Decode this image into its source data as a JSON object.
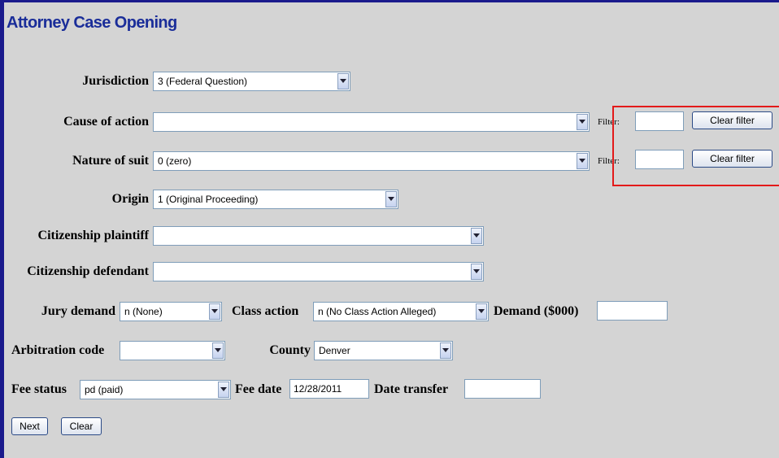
{
  "title": "Attorney Case Opening",
  "colors": {
    "title": "#1a2d99",
    "frame": "#1a1a8c",
    "highlight": "#e31a1a",
    "background": "#d4d4d4"
  },
  "fields": {
    "jurisdiction": {
      "label": "Jurisdiction",
      "value": "3 (Federal Question)"
    },
    "cause_of_action": {
      "label": "Cause of action",
      "value": ""
    },
    "nature_of_suit": {
      "label": "Nature of suit",
      "value": "0 (zero)"
    },
    "origin": {
      "label": "Origin",
      "value": "1 (Original Proceeding)"
    },
    "citizenship_plaintiff": {
      "label": "Citizenship plaintiff",
      "value": ""
    },
    "citizenship_defendant": {
      "label": "Citizenship defendant",
      "value": ""
    },
    "jury_demand": {
      "label": "Jury demand",
      "value": "n (None)"
    },
    "class_action": {
      "label": "Class action",
      "value": "n (No Class Action Alleged)"
    },
    "demand": {
      "label": "Demand ($000)",
      "value": ""
    },
    "arbitration_code": {
      "label": "Arbitration code",
      "value": ""
    },
    "county": {
      "label": "County",
      "value": "Denver"
    },
    "fee_status": {
      "label": "Fee status",
      "value": "pd (paid)"
    },
    "fee_date": {
      "label": "Fee date",
      "value": "12/28/2011"
    },
    "date_transfer": {
      "label": "Date transfer",
      "value": ""
    }
  },
  "filters": {
    "label": "Filter:",
    "cause_value": "",
    "nature_value": "",
    "clear_label": "Clear filter"
  },
  "buttons": {
    "next": "Next",
    "clear": "Clear"
  },
  "icons": {
    "dropdown": "chevron-down-icon"
  }
}
